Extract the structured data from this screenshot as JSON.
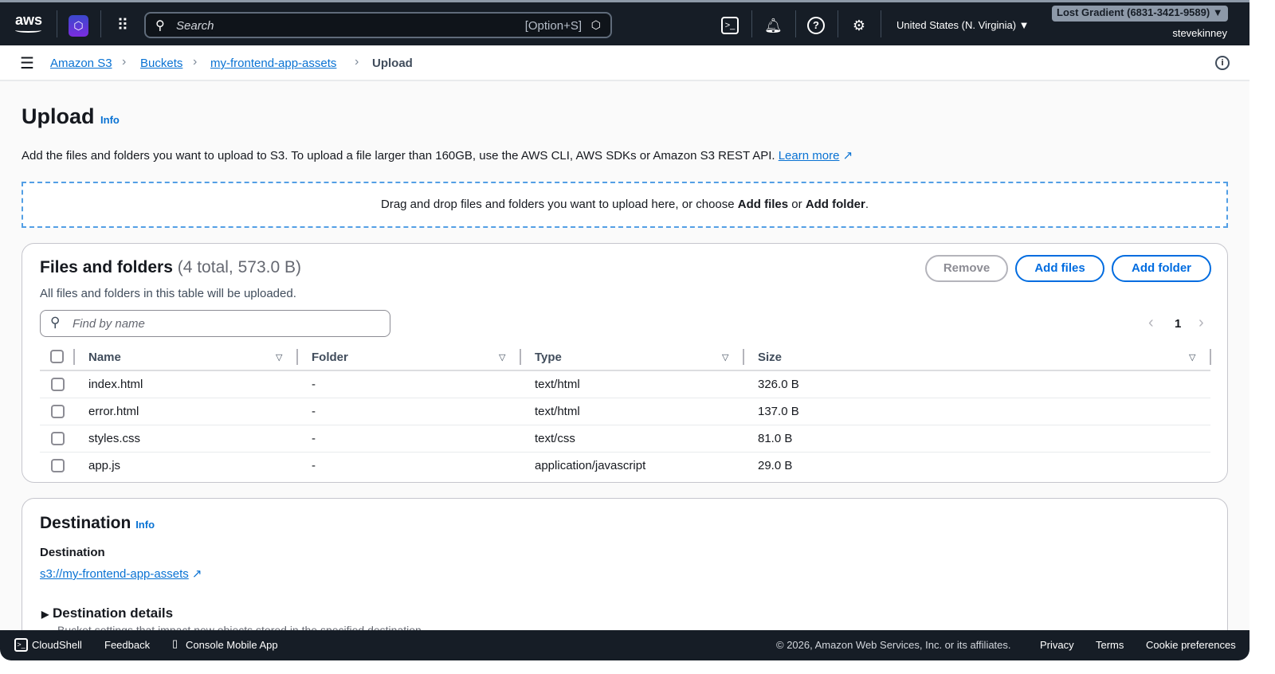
{
  "nav": {
    "logo": "aws",
    "search_placeholder": "Search",
    "search_shortcut": "[Option+S]",
    "region": "United States (N. Virginia) ▼",
    "account": "Lost Gradient (6831-3421-9589) ▼",
    "user": "stevekinney"
  },
  "breadcrumbs": [
    "Amazon S3",
    "Buckets",
    "my-frontend-app-assets",
    "Upload"
  ],
  "page": {
    "title": "Upload",
    "info": "Info",
    "description": "Add the files and folders you want to upload to S3. To upload a file larger than 160GB, use the AWS CLI, AWS SDKs or Amazon S3 REST API.",
    "learn_more": "Learn more",
    "drop_text_1": "Drag and drop files and folders you want to upload here, or choose ",
    "drop_bold_1": "Add files",
    "drop_text_2": " or ",
    "drop_bold_2": "Add folder",
    "drop_text_3": "."
  },
  "files": {
    "title": "Files and folders",
    "count": "(4 total, 573.0 B)",
    "subtitle": "All files and folders in this table will be uploaded.",
    "remove": "Remove",
    "add_files": "Add files",
    "add_folder": "Add folder",
    "filter_placeholder": "Find by name",
    "page": "1",
    "columns": [
      "Name",
      "Folder",
      "Type",
      "Size"
    ],
    "rows": [
      {
        "name": "index.html",
        "folder": "-",
        "type": "text/html",
        "size": "326.0 B"
      },
      {
        "name": "error.html",
        "folder": "-",
        "type": "text/html",
        "size": "137.0 B"
      },
      {
        "name": "styles.css",
        "folder": "-",
        "type": "text/css",
        "size": "81.0 B"
      },
      {
        "name": "app.js",
        "folder": "-",
        "type": "application/javascript",
        "size": "29.0 B"
      }
    ]
  },
  "destination": {
    "title": "Destination",
    "info": "Info",
    "label": "Destination",
    "uri": "s3://my-frontend-app-assets",
    "details": "Destination details",
    "details_desc": "Bucket settings that impact new objects stored in the specified destination."
  },
  "footer": {
    "cloudshell": "CloudShell",
    "feedback": "Feedback",
    "mobile": "Console Mobile App",
    "copyright": "© 2026, Amazon Web Services, Inc. or its affiliates.",
    "privacy": "Privacy",
    "terms": "Terms",
    "cookies": "Cookie preferences"
  }
}
